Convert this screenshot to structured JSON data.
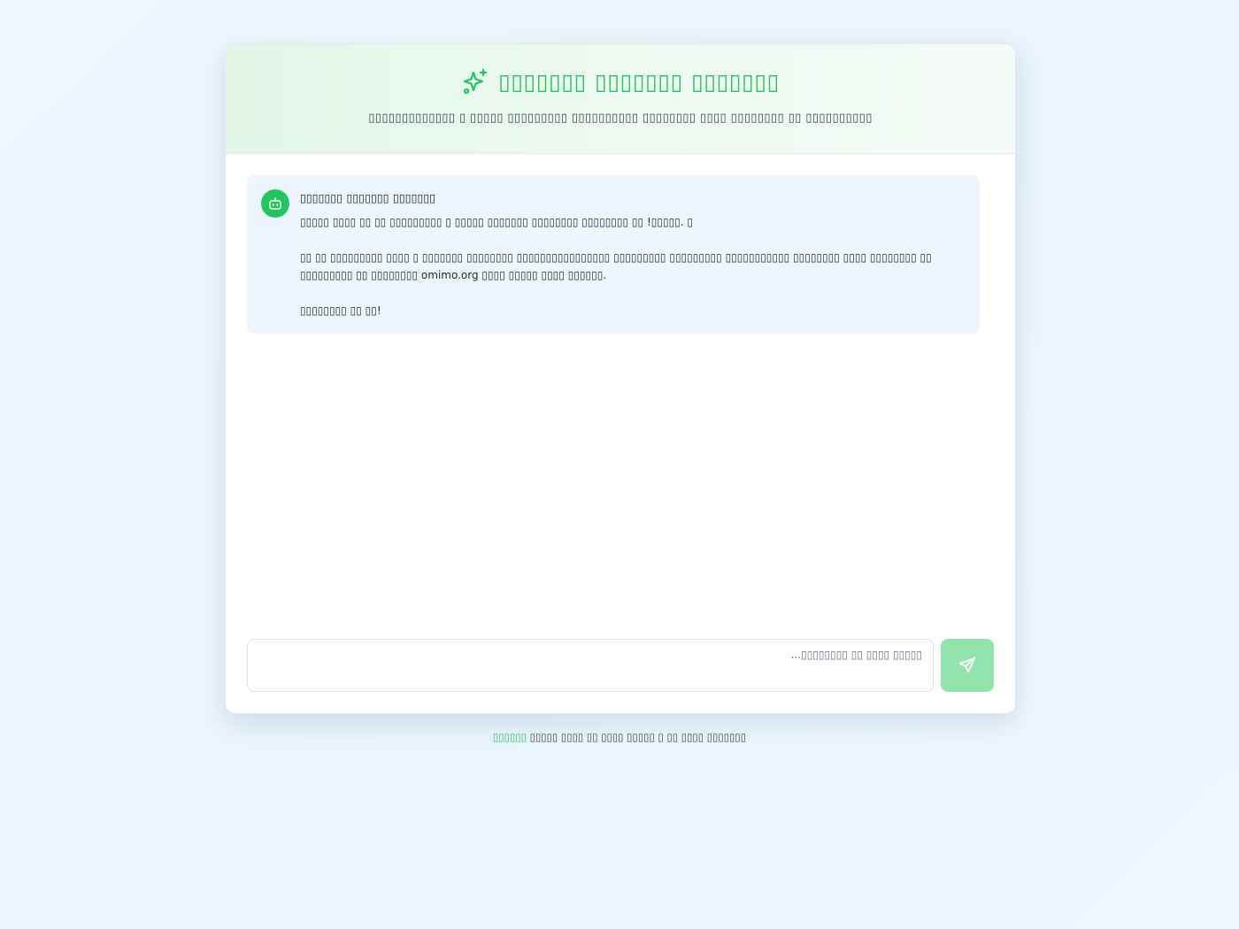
{
  "header": {
    "title": "▯▯▯▯▯▯▯ ▯▯▯▯▯▯▯ ▯▯▯▯▯▯▯",
    "subtitle": "▯▯▯▯▯▯▯▯▯▯▯▯▯ ▯ ▯▯▯▯▯ ▯▯▯▯▯▯▯▯▯ ▯▯▯▯▯▯▯▯▯▯ ▯▯▯▯▯▯▯▯ ▯▯▯▯ ▯▯▯▯▯▯▯▯ ▯▯ ▯▯▯▯▯▯▯▯▯▯",
    "icon": "sparkles-icon"
  },
  "chat": {
    "messages": [
      {
        "sender": "▯▯▯▯▯▯▯ ▯▯▯▯▯▯▯ ▯▯▯▯▯▯▯",
        "line1": "▯▯▯▯▯ ▯▯▯▯ ▯▯ ▯▯ ▯▯▯▯▯▯▯▯▯ ▯ ▯▯▯▯▯ ▯▯▯▯▯▯▯ ▯▯▯▯▯▯▯▯ ▯▯▯▯▯▯▯▯ ▯▯ !▯▯▯▯▯. ▯",
        "line2": "▯▯ ▯▯ ▯▯▯▯▯▯▯▯▯ ▯▯▯▯ ▯ ▯▯▯▯▯▯▯ ▯▯▯▯▯▯▯▯ ▯▯▯▯▯▯▯▯▯▯▯▯▯▯▯▯ ▯▯▯▯▯▯▯▯▯ ▯▯▯▯▯▯▯▯▯ ▯▯▯▯▯▯▯▯▯▯▯ ▯▯▯▯▯▯▯▯ ▯▯▯▯ ▯▯▯▯▯▯▯▯ ▯▯ ▯▯▯▯▯▯▯▯▯ ▯▯ ▯▯▯▯▯▯▯▯ omimo.org ▯▯▯▯ ▯▯▯▯▯ ▯▯▯▯ ▯▯▯▯▯▯.",
        "line3": "▯▯▯▯▯▯▯▯ ▯▯ ▯▯!",
        "avatar": "robot-icon"
      }
    ]
  },
  "composer": {
    "placeholder": "...▯▯▯▯▯▯▯▯ ▯▯ ▯▯▯▯ ▯▯▯▯▯",
    "send_icon": "send-icon"
  },
  "footer": {
    "brand": "▯▯▯▯▯▯",
    "text": "▯▯▯▯▯ ▯▯▯▯ ▯▯ ▯▯▯▯ ▯▯▯▯▯ ▯ ▯▯ ▯▯▯▯ ▯▯▯▯▯▯▯"
  },
  "colors": {
    "accent": "#22c55e",
    "send_button": "#93e4ac",
    "message_bg": "#edf5fe"
  }
}
